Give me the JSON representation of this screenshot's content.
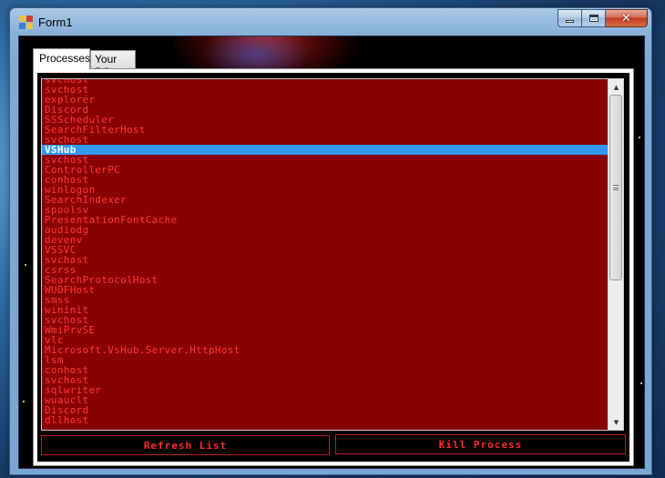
{
  "window": {
    "title": "Form1",
    "caption_buttons": {
      "minimize_icon": "minimize-icon",
      "maximize_icon": "maximize-icon",
      "close_icon": "close-icon"
    }
  },
  "tabs": [
    {
      "label": "Processes",
      "active": true
    },
    {
      "label": "Your PC",
      "active": false
    }
  ],
  "process_list": {
    "selected_index": 7,
    "items": [
      "svchost",
      "svchost",
      "explorer",
      "Discord",
      "SSScheduler",
      "SearchFilterHost",
      "svchost",
      "VSHub",
      "svchost",
      "ControllerPC",
      "conhost",
      "winlogon",
      "SearchIndexer",
      "spoolsv",
      "PresentationFontCache",
      "audiodg",
      "devenv",
      "VSSVC",
      "svchost",
      "csrss",
      "SearchProtocolHost",
      "WUDFHost",
      "smss",
      "wininit",
      "svchost",
      "WmiPrvSE",
      "vlc",
      "Microsoft.VsHub.Server.HttpHost",
      "lsm",
      "conhost",
      "svchost",
      "sqlwriter",
      "wuauclt",
      "Discord",
      "dllhost"
    ]
  },
  "buttons": {
    "refresh_label": "Refresh List",
    "kill_label": "Kill Process"
  },
  "colors": {
    "list_background": "#890000",
    "list_text": "#ff3838",
    "selection": "#3399ff",
    "button_text": "#ff2a2a",
    "button_border": "#b91e1e"
  }
}
